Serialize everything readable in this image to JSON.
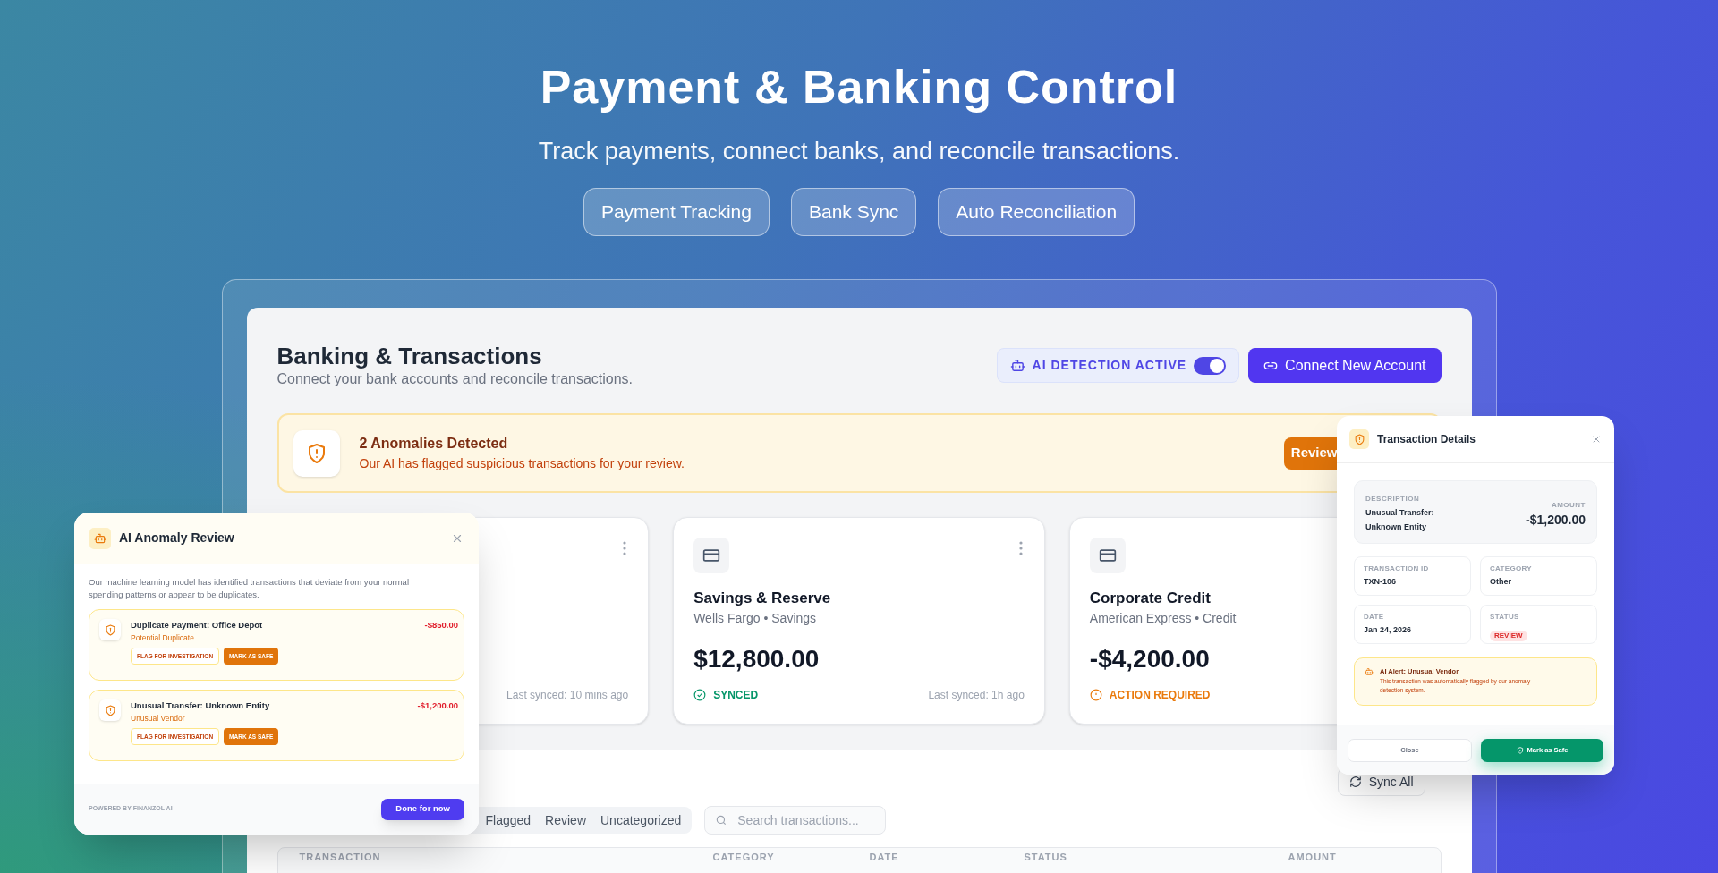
{
  "hero": {
    "title": "Payment & Banking Control",
    "subtitle": "Track payments, connect banks, and reconcile transactions.",
    "features": [
      "Payment Tracking",
      "Bank Sync",
      "Auto Reconciliation"
    ]
  },
  "panel": {
    "title": "Banking & Transactions",
    "subtitle": "Connect your bank accounts and reconcile transactions.",
    "ai_detection": {
      "label": "AI DETECTION ACTIVE",
      "on": true
    },
    "connect_button": "Connect New Account"
  },
  "alert": {
    "title": "2 Anomalies Detected",
    "message": "Our AI has flagged suspicious transactions for your review.",
    "button": "Review"
  },
  "accounts": [
    {
      "has_menu": true,
      "last_synced": "Last synced: 10 mins ago"
    },
    {
      "has_menu": true,
      "name": "Savings & Reserve",
      "institution": "Wells Fargo • Savings",
      "balance": "$12,800.00",
      "status": {
        "kind": "synced",
        "label": "SYNCED"
      },
      "last_synced": "Last synced: 1h ago"
    },
    {
      "has_menu": false,
      "name": "Corporate Credit",
      "institution": "American Express • Credit",
      "balance": "-$4,200.00",
      "status": {
        "kind": "action",
        "label": "ACTION REQUIRED"
      }
    }
  ],
  "transactions": {
    "sync_button": "Sync All",
    "filters": [
      {
        "label": "Flagged",
        "selected": false
      },
      {
        "label": "Review",
        "selected": false
      },
      {
        "label": "Uncategorized",
        "selected": false
      }
    ],
    "search": {
      "placeholder": "Search transactions..."
    },
    "columns": [
      "TRANSACTION",
      "CATEGORY",
      "DATE",
      "STATUS",
      "AMOUNT"
    ]
  },
  "anomaly_review": {
    "title": "AI Anomaly Review",
    "intro": "Our machine learning model has identified transactions that deviate from your normal spending patterns or appear to be duplicates.",
    "items": [
      {
        "title": "Duplicate Payment: Office Depot",
        "reason": "Potential Duplicate",
        "amount": "-$850.00",
        "actions": [
          "FLAG FOR INVESTIGATION",
          "MARK AS SAFE"
        ]
      },
      {
        "title": "Unusual Transfer: Unknown Entity",
        "reason": "Unusual Vendor",
        "amount": "-$1,200.00",
        "actions": [
          "FLAG FOR INVESTIGATION",
          "MARK AS SAFE"
        ]
      }
    ],
    "footer_note": "POWERED BY FINANZOL AI",
    "done_button": "Done for now"
  },
  "transaction_details": {
    "title": "Transaction Details",
    "description_label": "DESCRIPTION",
    "description": "Unusual Transfer: Unknown Entity",
    "amount_label": "AMOUNT",
    "amount": "-$1,200.00",
    "fields": [
      {
        "kind": "text",
        "label": "TRANSACTION ID",
        "value": "TXN-106"
      },
      {
        "kind": "text",
        "label": "CATEGORY",
        "value": "Other"
      },
      {
        "kind": "text",
        "label": "DATE",
        "value": "Jan 24, 2026"
      },
      {
        "kind": "badge",
        "label": "STATUS",
        "value": "REVIEW"
      }
    ],
    "alert": {
      "title": "AI Alert: Unusual Vendor",
      "message": "This transaction was automatically flagged by our anomaly detection system."
    },
    "buttons": [
      "Close",
      "Mark as Safe"
    ]
  }
}
